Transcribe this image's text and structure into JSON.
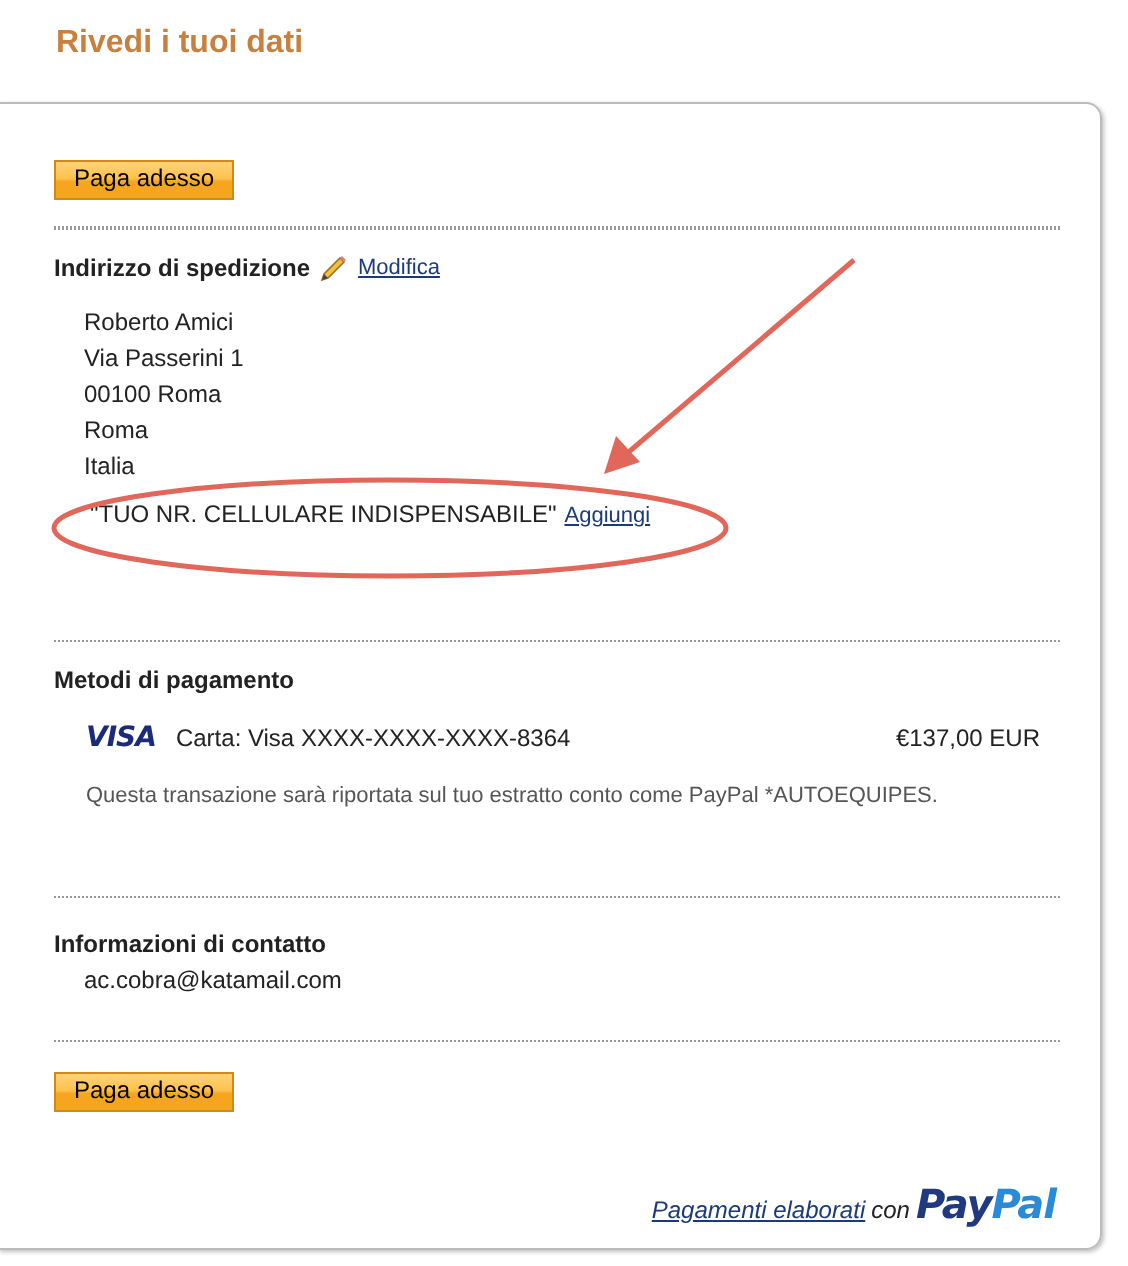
{
  "title": "Rivedi i tuoi dati",
  "top_button": "Paga adesso",
  "shipping": {
    "heading": "Indirizzo di spedizione",
    "edit_link": "Modifica",
    "address_lines": [
      "Roberto Amici",
      "Via Passerini 1",
      "00100 Roma",
      "Roma",
      "Italia"
    ],
    "phone_note": "\"TUO NR. CELLULARE INDISPENSABILE\"",
    "add_link": "Aggiungi"
  },
  "payment": {
    "heading": "Metodi di pagamento",
    "card_brand": "VISA",
    "card": "Carta: Visa XXXX-XXXX-XXXX-8364",
    "amount": "€137,00 EUR",
    "note": "Questa transazione sarà riportata sul tuo estratto conto come PayPal *AUTOEQUIPES."
  },
  "contact": {
    "heading": "Informazioni di contatto",
    "email": "ac.cobra@katamail.com"
  },
  "bottom_button": "Paga adesso",
  "footer": {
    "link": "Pagamenti elaborati",
    "word": "con",
    "logo_parts": [
      "Pay",
      "Pal"
    ]
  }
}
